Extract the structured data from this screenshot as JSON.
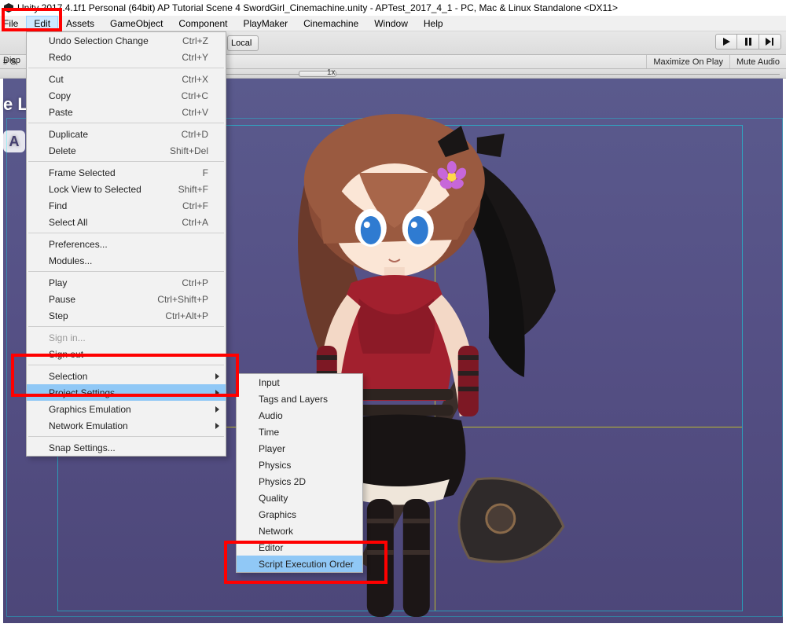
{
  "title": "Unity 2017.4.1f1 Personal (64bit) AP Tutorial Scene 4 SwordGirl_Cinemachine.unity - APTest_2017_4_1 - PC, Mac & Linux Standalone <DX11>",
  "menubar": {
    "file": "File",
    "edit": "Edit",
    "assets": "Assets",
    "gameobject": "GameObject",
    "component": "Component",
    "playmaker": "PlayMaker",
    "cinemachine": "Cinemachine",
    "window": "Window",
    "help": "Help"
  },
  "toolbar": {
    "local": "Local",
    "display": "Disp",
    "hash": "# S",
    "zoom": "1x",
    "maximize": "Maximize On Play",
    "mute": "Mute Audio"
  },
  "left_overlay": {
    "line1": "e L",
    "pill": "A"
  },
  "edit_menu": {
    "undo": {
      "label": "Undo Selection Change",
      "sc": "Ctrl+Z"
    },
    "redo": {
      "label": "Redo",
      "sc": "Ctrl+Y"
    },
    "cut": {
      "label": "Cut",
      "sc": "Ctrl+X"
    },
    "copy": {
      "label": "Copy",
      "sc": "Ctrl+C"
    },
    "paste": {
      "label": "Paste",
      "sc": "Ctrl+V"
    },
    "duplicate": {
      "label": "Duplicate",
      "sc": "Ctrl+D"
    },
    "delete": {
      "label": "Delete",
      "sc": "Shift+Del"
    },
    "frame": {
      "label": "Frame Selected",
      "sc": "F"
    },
    "lockview": {
      "label": "Lock View to Selected",
      "sc": "Shift+F"
    },
    "find": {
      "label": "Find",
      "sc": "Ctrl+F"
    },
    "selall": {
      "label": "Select All",
      "sc": "Ctrl+A"
    },
    "prefs": {
      "label": "Preferences..."
    },
    "modules": {
      "label": "Modules..."
    },
    "play": {
      "label": "Play",
      "sc": "Ctrl+P"
    },
    "pause": {
      "label": "Pause",
      "sc": "Ctrl+Shift+P"
    },
    "step": {
      "label": "Step",
      "sc": "Ctrl+Alt+P"
    },
    "signin": {
      "label": "Sign in..."
    },
    "signout": {
      "label": "Sign out"
    },
    "selection": {
      "label": "Selection"
    },
    "project_settings": {
      "label": "Project Settings"
    },
    "graphics_emu": {
      "label": "Graphics Emulation"
    },
    "network_emu": {
      "label": "Network Emulation"
    },
    "snap": {
      "label": "Snap Settings..."
    }
  },
  "project_settings_menu": {
    "input": "Input",
    "tags": "Tags and Layers",
    "audio": "Audio",
    "time": "Time",
    "player": "Player",
    "physics": "Physics",
    "physics2d": "Physics 2D",
    "quality": "Quality",
    "graphics": "Graphics",
    "network": "Network",
    "editor": "Editor",
    "seo": "Script Execution Order"
  }
}
